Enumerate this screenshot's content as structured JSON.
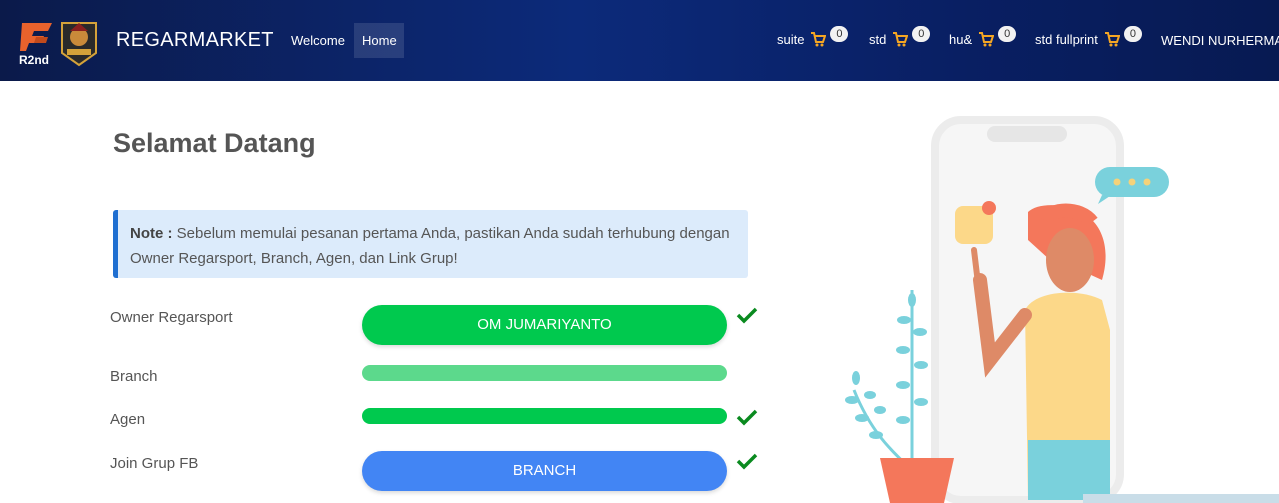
{
  "navbar": {
    "logo_text": "R2nd",
    "brand": "REGARMARKET",
    "links": [
      {
        "label": "Welcome",
        "active": false
      },
      {
        "label": "Home",
        "active": true
      }
    ],
    "carts": [
      {
        "label": "suite",
        "count": "0"
      },
      {
        "label": "std",
        "count": "0"
      },
      {
        "label": "hu&",
        "count": "0"
      },
      {
        "label": "std fullprint",
        "count": "0"
      }
    ],
    "user": "WENDI NURHERMA"
  },
  "main": {
    "title": "Selamat Datang",
    "note_label": "Note :",
    "note_text": " Sebelum memulai pesanan pertama Anda, pastikan Anda sudah terhubung dengan Owner Regarsport, Branch, Agen, dan Link Grup!",
    "rows": [
      {
        "label": "Owner Regarsport",
        "value": "OM JUMARIYANTO",
        "checked": true
      },
      {
        "label": "Branch",
        "value": "",
        "checked": false
      },
      {
        "label": "Agen",
        "value": "",
        "checked": true
      },
      {
        "label": "Join Grup FB",
        "value": "BRANCH",
        "checked": true
      }
    ]
  },
  "colors": {
    "accent_green": "#00c94e",
    "accent_blue": "#4285f4",
    "cart_orange": "#f5a623",
    "check_green": "#0a8a1f"
  },
  "icons": [
    "cart-icon",
    "check-icon"
  ]
}
